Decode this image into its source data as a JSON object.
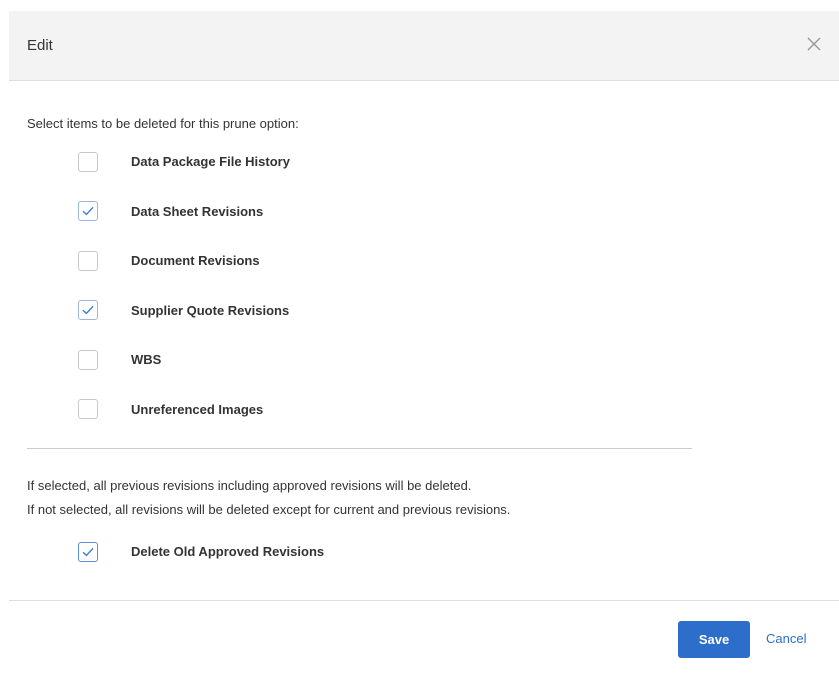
{
  "dialog": {
    "title": "Edit",
    "close_icon": "close-icon"
  },
  "prune": {
    "instructions": "Select items to be deleted for this prune option:",
    "options": [
      {
        "label": "Data Package File History",
        "checked": false
      },
      {
        "label": "Data Sheet Revisions",
        "checked": true
      },
      {
        "label": "Document Revisions",
        "checked": false
      },
      {
        "label": "Supplier Quote Revisions",
        "checked": true
      },
      {
        "label": "WBS",
        "checked": false
      },
      {
        "label": "Unreferenced Images",
        "checked": false
      }
    ]
  },
  "approved": {
    "note_selected": "If selected, all previous revisions including approved revisions will be deleted.",
    "note_not_selected": "If not selected, all revisions will be deleted except for current and previous revisions.",
    "label": "Delete Old Approved Revisions",
    "checked": true
  },
  "footer": {
    "save_label": "Save",
    "cancel_label": "Cancel"
  },
  "colors": {
    "accent": "#2d6ecb",
    "header_bg": "#f3f3f3"
  }
}
